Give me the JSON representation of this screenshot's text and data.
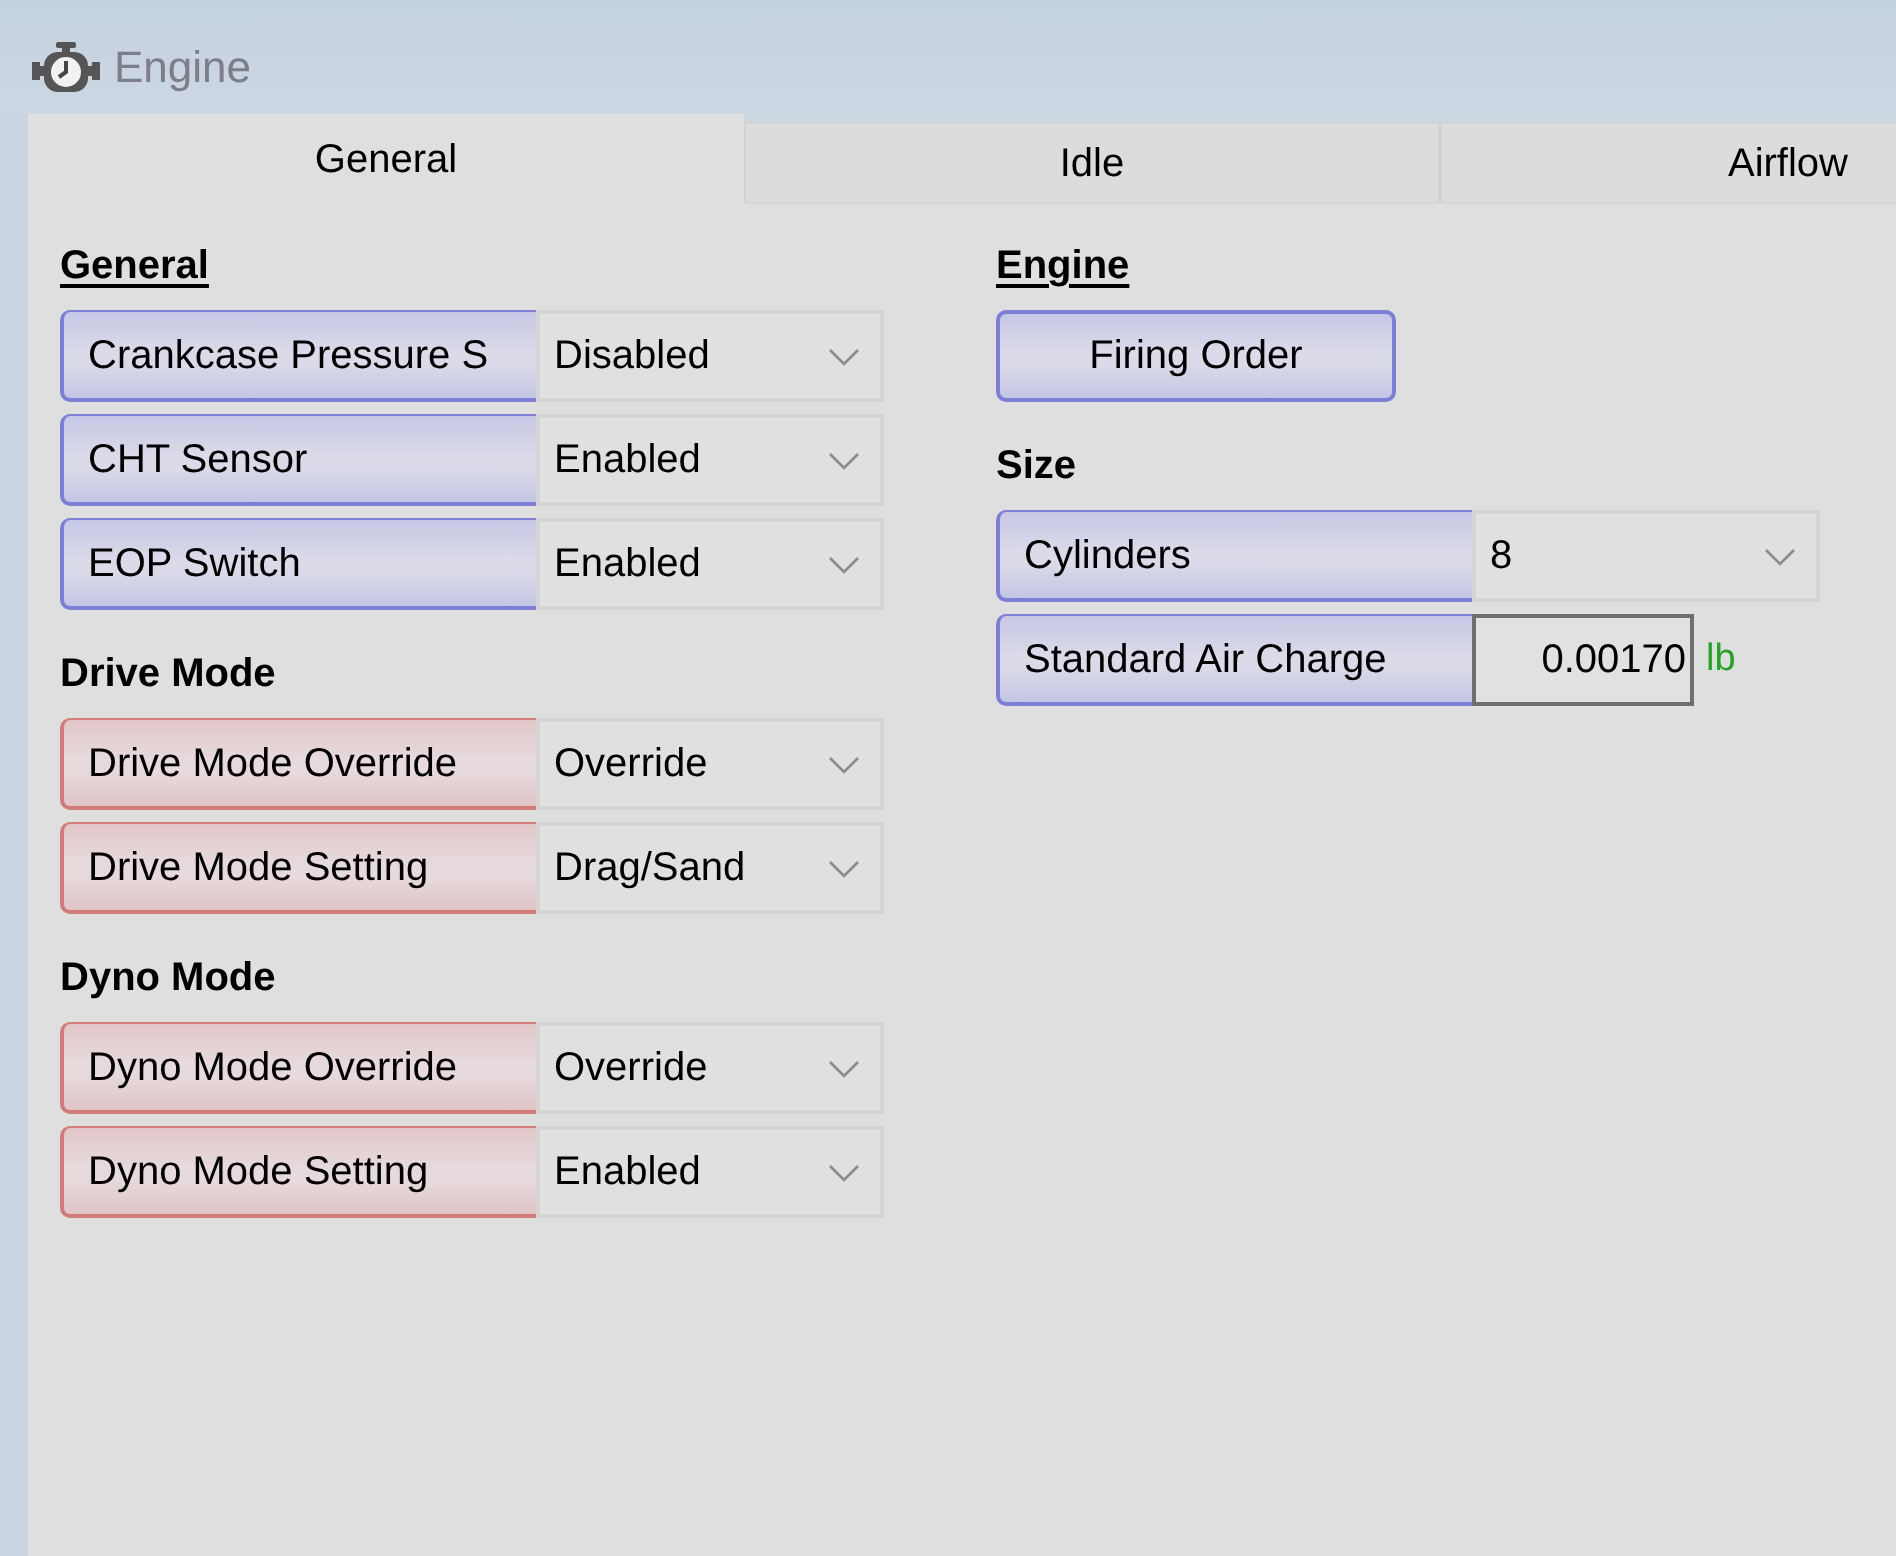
{
  "window": {
    "title": "Engine"
  },
  "tabs": [
    {
      "label": "General",
      "selected": true
    },
    {
      "label": "Idle",
      "selected": false
    },
    {
      "label": "Airflow",
      "selected": false
    }
  ],
  "columns": [
    {
      "sections": [
        {
          "heading": "General",
          "underlined": true,
          "rows": [
            {
              "kind": "dropdown",
              "label": "Crankcase Pressure S",
              "value": "Disabled",
              "color": "#7b7fd6"
            },
            {
              "kind": "dropdown",
              "label": "CHT Sensor",
              "value": "Enabled",
              "color": "#7b7fd6"
            },
            {
              "kind": "dropdown",
              "label": "EOP Switch",
              "value": "Enabled",
              "color": "#7b7fd6"
            }
          ]
        },
        {
          "heading": "Drive Mode",
          "underlined": false,
          "rows": [
            {
              "kind": "dropdown",
              "label": "Drive Mode Override",
              "value": "Override",
              "color": "#d27b7b"
            },
            {
              "kind": "dropdown",
              "label": "Drive Mode Setting",
              "value": "Drag/Sand",
              "color": "#d27b7b"
            }
          ]
        },
        {
          "heading": "Dyno Mode",
          "underlined": false,
          "rows": [
            {
              "kind": "dropdown",
              "label": "Dyno Mode Override",
              "value": "Override",
              "color": "#d27b7b"
            },
            {
              "kind": "dropdown",
              "label": "Dyno Mode Setting",
              "value": "Enabled",
              "color": "#d27b7b"
            }
          ]
        }
      ]
    },
    {
      "sections": [
        {
          "heading": "Engine",
          "underlined": true,
          "rows": [
            {
              "kind": "button",
              "label": "Firing Order",
              "color": "#7b7fd6"
            }
          ]
        },
        {
          "heading": "Size",
          "underlined": false,
          "rows": [
            {
              "kind": "dropdown",
              "label": "Cylinders",
              "value": "8",
              "color": "#7b7fd6"
            },
            {
              "kind": "number",
              "label": "Standard Air Charge",
              "value": "0.00170",
              "unit": "lb",
              "color": "#7b7fd6"
            }
          ]
        }
      ]
    }
  ]
}
